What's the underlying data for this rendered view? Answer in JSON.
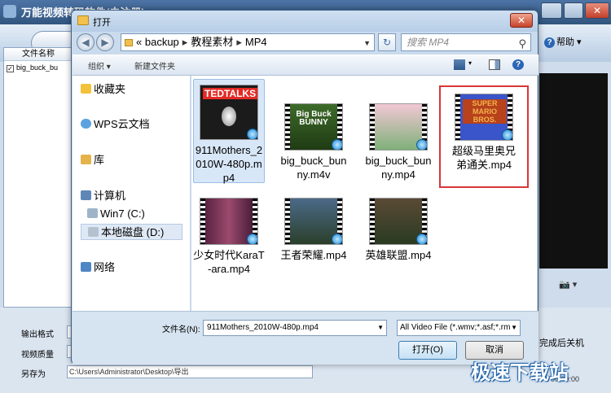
{
  "background_app": {
    "title": "万能视频转码软件(未注册)",
    "help_label": "帮助",
    "filelist_header": "文件名称",
    "filelist_item": "big_buck_bu",
    "labels": {
      "output_format": "输出格式",
      "video_quality": "视频质量",
      "save_as": "另存为"
    },
    "save_path": "C:\\Users\\Administrator\\Desktop\\导出",
    "after_finish": "完成后关机",
    "time": "00:00:00"
  },
  "dialog": {
    "title": "打开",
    "address": {
      "prefix": "«",
      "parts": [
        "backup",
        "教程素材",
        "MP4"
      ]
    },
    "search_placeholder": "搜索 MP4",
    "toolbar": {
      "organize": "组织 ▾",
      "new_folder": "新建文件夹"
    },
    "nav": [
      {
        "label": "收藏夹"
      },
      {
        "label": "WPS云文档"
      },
      {
        "label": "库"
      },
      {
        "label": "计算机"
      },
      {
        "label": "Win7 (C:)"
      },
      {
        "label": "本地磁盘 (D:)"
      },
      {
        "label": "网络"
      }
    ],
    "files": [
      {
        "name": "911Mothers_2010W-480p.mp4",
        "thumb": "TEDTALKS"
      },
      {
        "name": "big_buck_bunny.m4v",
        "thumb": "Big Buck BUNNY"
      },
      {
        "name": "big_buck_bunny.mp4",
        "thumb": ""
      },
      {
        "name": "超级马里奥兄弟通关.mp4",
        "thumb": "SUPER MARIO BROS."
      },
      {
        "name": "少女时代KaraT-ara.mp4",
        "thumb": ""
      },
      {
        "name": "王者荣耀.mp4",
        "thumb": ""
      },
      {
        "name": "英雄联盟.mp4",
        "thumb": ""
      }
    ],
    "filename_label": "文件名(N):",
    "filename_value": "911Mothers_2010W-480p.mp4",
    "filetype_value": "All Video File (*.wmv;*.asf;*.rm",
    "open_button": "打开(O)",
    "cancel_button": "取消"
  },
  "watermark": "极速下载站",
  "colors": {
    "selection": "#d8e7f8",
    "highlight": "#d83737",
    "titlebar": "#31567f"
  }
}
